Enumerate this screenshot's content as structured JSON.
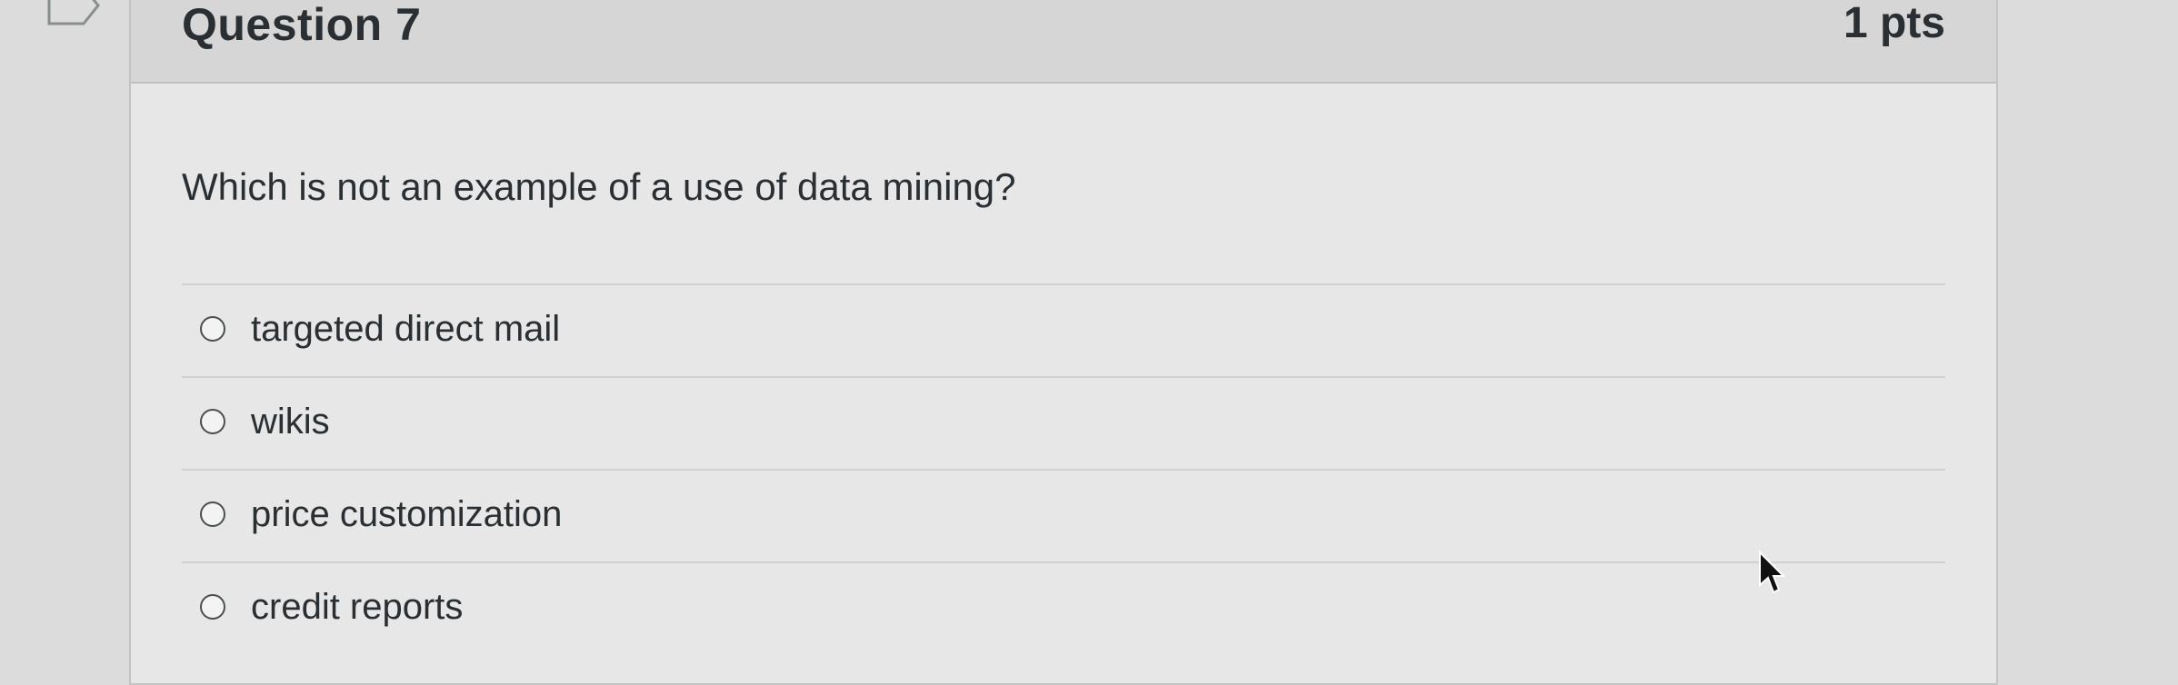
{
  "question": {
    "title": "Question 7",
    "points": "1 pts",
    "text": "Which is not an example of a use of data mining?",
    "answers": [
      {
        "label": "targeted direct mail",
        "selected": false
      },
      {
        "label": "wikis",
        "selected": false
      },
      {
        "label": "price customization",
        "selected": false
      },
      {
        "label": "credit reports",
        "selected": false
      }
    ]
  },
  "icons": {
    "flag": "bookmark-flag-icon",
    "pointer": "mouse-pointer-icon"
  }
}
